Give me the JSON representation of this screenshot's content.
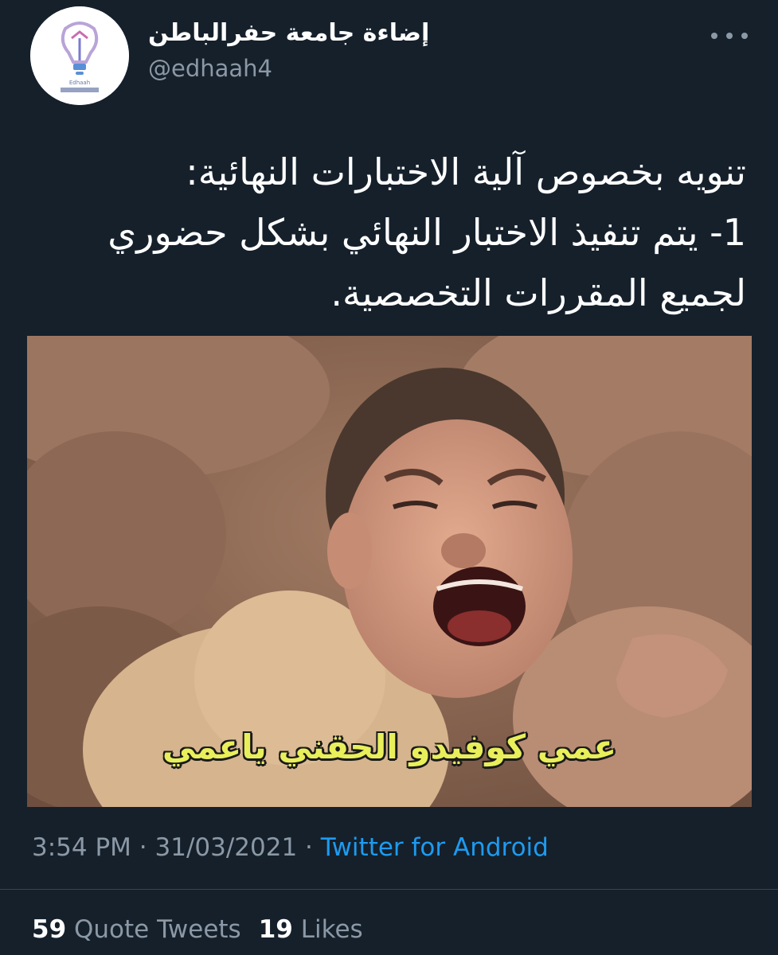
{
  "account": {
    "display_name": "إضاءة جامعة حفرالباطن",
    "handle": "@edhaah4",
    "avatar_icon": "edhaah-logo-icon",
    "avatar_logo_text": "Edhaah"
  },
  "more_icon": "more-options-icon",
  "tweet": {
    "lines": [
      "تنويه بخصوص آلية الاختبارات النهائية:",
      "1- يتم تنفيذ الاختبار النهائي بشكل حضوري",
      "لجميع المقررات التخصصية."
    ]
  },
  "media": {
    "caption": "عمي كوفيدو الحقني ياعمي"
  },
  "meta": {
    "time": "3:54 PM",
    "separator": "·",
    "date": "31/03/2021",
    "source": "Twitter for Android"
  },
  "stats": {
    "quote_count": "59",
    "quote_label": "Quote Tweets",
    "like_count": "19",
    "like_label": "Likes"
  },
  "colors": {
    "background": "#15202b",
    "secondary_text": "#8b98a5",
    "link": "#1d9bf0",
    "caption_yellow": "#e8ef5a"
  }
}
